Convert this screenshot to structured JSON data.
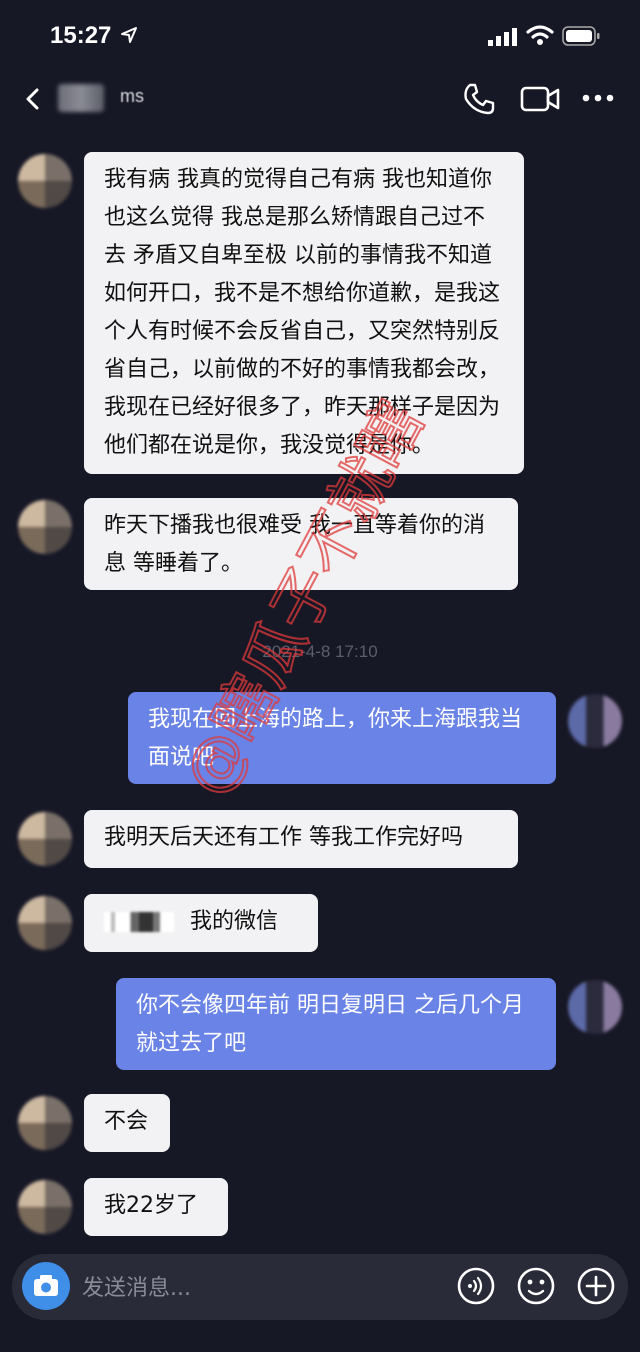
{
  "status_bar": {
    "time": "15:27"
  },
  "header": {
    "contact_name": "ms"
  },
  "messages": [
    {
      "side": "in",
      "text": "我有病 我真的觉得自己有病 我也知道你也这么觉得 我总是那么矫情跟自己过不去 矛盾又自卑至极 以前的事情我不知道如何开口，我不是不想给你道歉，是我这个人有时候不会反省自己，又突然特别反省自己，以前做的不好的事情我都会改，我现在已经好很多了，昨天那样子是因为他们都在说是你，我没觉得是你。"
    },
    {
      "side": "in",
      "text": "昨天下播我也很难受 我一直等着你的消息 等睡着了。"
    },
    {
      "timestamp": "2021-4-8 17:10"
    },
    {
      "side": "out",
      "text": "我现在回上海的路上，你来上海跟我当面说吧"
    },
    {
      "side": "in",
      "text": "我明天后天还有工作 等我工作完好吗"
    },
    {
      "side": "in",
      "text": "我的微信"
    },
    {
      "side": "out",
      "text": "你不会像四年前 明日复明日 之后几个月就过去了吧"
    },
    {
      "side": "in",
      "text": "不会"
    },
    {
      "side": "in",
      "text": "我22岁了"
    }
  ],
  "watermark": "@瞎瓜子不就瞎",
  "input": {
    "placeholder": "发送消息..."
  },
  "colors": {
    "background": "#171826",
    "incoming": "#f2f2f4",
    "outgoing": "#6a83e6",
    "watermark": "#e03a3a"
  }
}
